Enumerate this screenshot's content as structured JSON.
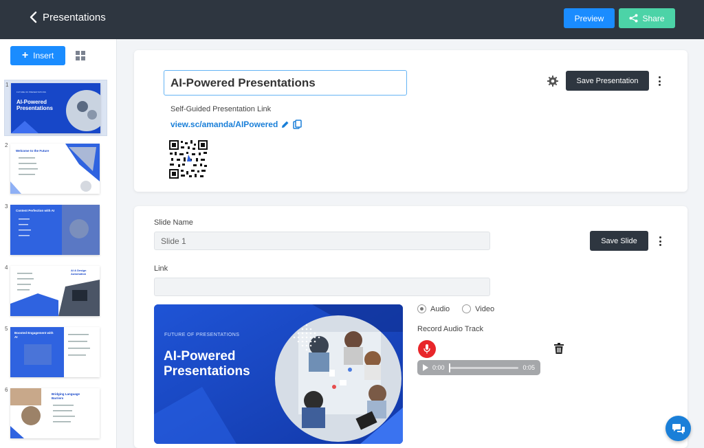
{
  "header": {
    "back_label": "Presentations",
    "preview_label": "Preview",
    "share_label": "Share"
  },
  "sidebar": {
    "insert_label": "Insert",
    "slides": [
      {
        "number": "1",
        "title": "AI-Powered Presentations",
        "selected": true
      },
      {
        "number": "2",
        "title": "Welcome to the Future"
      },
      {
        "number": "3",
        "title": "Content Perfection with AI"
      },
      {
        "number": "4",
        "title": "AI & Design Automation"
      },
      {
        "number": "5",
        "title": "Boosted Engagement with AI"
      },
      {
        "number": "6",
        "title": "Bridging Language Barriers"
      }
    ]
  },
  "presentation": {
    "title": "AI-Powered Presentations",
    "link_label": "Self-Guided Presentation Link",
    "link_url": "view.sc/amanda/AIPowered",
    "save_label": "Save Presentation"
  },
  "slide": {
    "name_label": "Slide Name",
    "name_value": "Slide 1",
    "link_label": "Link",
    "link_value": "",
    "save_label": "Save Slide",
    "preview_kicker": "FUTURE OF PRESENTATIONS",
    "preview_title_line1": "AI-Powered",
    "preview_title_line2": "Presentations",
    "media_options": [
      "Audio",
      "Video"
    ],
    "selected_media": "Audio",
    "record_label": "Record Audio Track",
    "audio_current": "0:00",
    "audio_duration": "0:05"
  },
  "colors": {
    "topbar": "#2e3640",
    "preview_blue": "#1a8cff",
    "share_green": "#4cd3a7",
    "slide_blue": "#1747c8",
    "record_red": "#e8262a"
  }
}
